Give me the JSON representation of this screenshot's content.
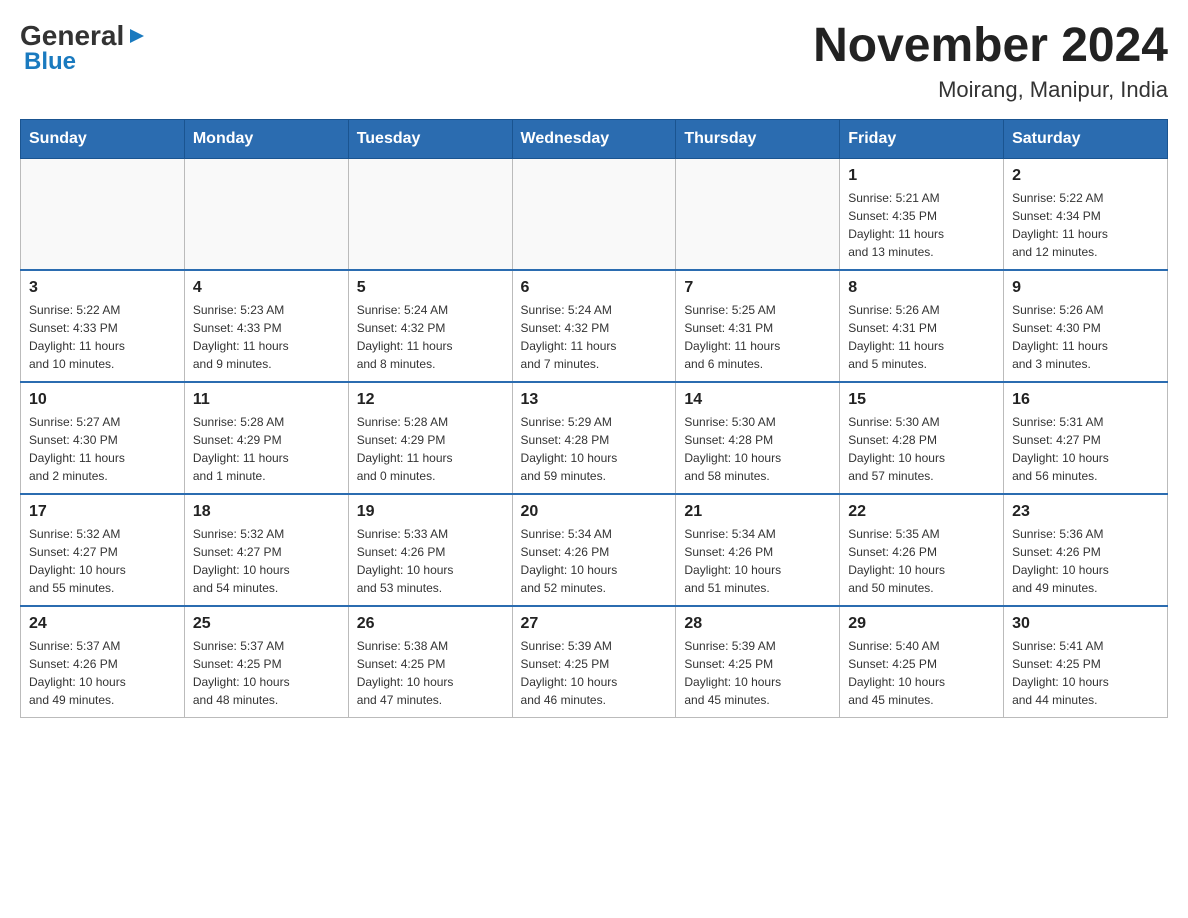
{
  "header": {
    "logo_general": "General",
    "logo_blue": "Blue",
    "month_title": "November 2024",
    "location": "Moirang, Manipur, India"
  },
  "days_of_week": [
    "Sunday",
    "Monday",
    "Tuesday",
    "Wednesday",
    "Thursday",
    "Friday",
    "Saturday"
  ],
  "weeks": [
    [
      {
        "day": "",
        "info": ""
      },
      {
        "day": "",
        "info": ""
      },
      {
        "day": "",
        "info": ""
      },
      {
        "day": "",
        "info": ""
      },
      {
        "day": "",
        "info": ""
      },
      {
        "day": "1",
        "info": "Sunrise: 5:21 AM\nSunset: 4:35 PM\nDaylight: 11 hours\nand 13 minutes."
      },
      {
        "day": "2",
        "info": "Sunrise: 5:22 AM\nSunset: 4:34 PM\nDaylight: 11 hours\nand 12 minutes."
      }
    ],
    [
      {
        "day": "3",
        "info": "Sunrise: 5:22 AM\nSunset: 4:33 PM\nDaylight: 11 hours\nand 10 minutes."
      },
      {
        "day": "4",
        "info": "Sunrise: 5:23 AM\nSunset: 4:33 PM\nDaylight: 11 hours\nand 9 minutes."
      },
      {
        "day": "5",
        "info": "Sunrise: 5:24 AM\nSunset: 4:32 PM\nDaylight: 11 hours\nand 8 minutes."
      },
      {
        "day": "6",
        "info": "Sunrise: 5:24 AM\nSunset: 4:32 PM\nDaylight: 11 hours\nand 7 minutes."
      },
      {
        "day": "7",
        "info": "Sunrise: 5:25 AM\nSunset: 4:31 PM\nDaylight: 11 hours\nand 6 minutes."
      },
      {
        "day": "8",
        "info": "Sunrise: 5:26 AM\nSunset: 4:31 PM\nDaylight: 11 hours\nand 5 minutes."
      },
      {
        "day": "9",
        "info": "Sunrise: 5:26 AM\nSunset: 4:30 PM\nDaylight: 11 hours\nand 3 minutes."
      }
    ],
    [
      {
        "day": "10",
        "info": "Sunrise: 5:27 AM\nSunset: 4:30 PM\nDaylight: 11 hours\nand 2 minutes."
      },
      {
        "day": "11",
        "info": "Sunrise: 5:28 AM\nSunset: 4:29 PM\nDaylight: 11 hours\nand 1 minute."
      },
      {
        "day": "12",
        "info": "Sunrise: 5:28 AM\nSunset: 4:29 PM\nDaylight: 11 hours\nand 0 minutes."
      },
      {
        "day": "13",
        "info": "Sunrise: 5:29 AM\nSunset: 4:28 PM\nDaylight: 10 hours\nand 59 minutes."
      },
      {
        "day": "14",
        "info": "Sunrise: 5:30 AM\nSunset: 4:28 PM\nDaylight: 10 hours\nand 58 minutes."
      },
      {
        "day": "15",
        "info": "Sunrise: 5:30 AM\nSunset: 4:28 PM\nDaylight: 10 hours\nand 57 minutes."
      },
      {
        "day": "16",
        "info": "Sunrise: 5:31 AM\nSunset: 4:27 PM\nDaylight: 10 hours\nand 56 minutes."
      }
    ],
    [
      {
        "day": "17",
        "info": "Sunrise: 5:32 AM\nSunset: 4:27 PM\nDaylight: 10 hours\nand 55 minutes."
      },
      {
        "day": "18",
        "info": "Sunrise: 5:32 AM\nSunset: 4:27 PM\nDaylight: 10 hours\nand 54 minutes."
      },
      {
        "day": "19",
        "info": "Sunrise: 5:33 AM\nSunset: 4:26 PM\nDaylight: 10 hours\nand 53 minutes."
      },
      {
        "day": "20",
        "info": "Sunrise: 5:34 AM\nSunset: 4:26 PM\nDaylight: 10 hours\nand 52 minutes."
      },
      {
        "day": "21",
        "info": "Sunrise: 5:34 AM\nSunset: 4:26 PM\nDaylight: 10 hours\nand 51 minutes."
      },
      {
        "day": "22",
        "info": "Sunrise: 5:35 AM\nSunset: 4:26 PM\nDaylight: 10 hours\nand 50 minutes."
      },
      {
        "day": "23",
        "info": "Sunrise: 5:36 AM\nSunset: 4:26 PM\nDaylight: 10 hours\nand 49 minutes."
      }
    ],
    [
      {
        "day": "24",
        "info": "Sunrise: 5:37 AM\nSunset: 4:26 PM\nDaylight: 10 hours\nand 49 minutes."
      },
      {
        "day": "25",
        "info": "Sunrise: 5:37 AM\nSunset: 4:25 PM\nDaylight: 10 hours\nand 48 minutes."
      },
      {
        "day": "26",
        "info": "Sunrise: 5:38 AM\nSunset: 4:25 PM\nDaylight: 10 hours\nand 47 minutes."
      },
      {
        "day": "27",
        "info": "Sunrise: 5:39 AM\nSunset: 4:25 PM\nDaylight: 10 hours\nand 46 minutes."
      },
      {
        "day": "28",
        "info": "Sunrise: 5:39 AM\nSunset: 4:25 PM\nDaylight: 10 hours\nand 45 minutes."
      },
      {
        "day": "29",
        "info": "Sunrise: 5:40 AM\nSunset: 4:25 PM\nDaylight: 10 hours\nand 45 minutes."
      },
      {
        "day": "30",
        "info": "Sunrise: 5:41 AM\nSunset: 4:25 PM\nDaylight: 10 hours\nand 44 minutes."
      }
    ]
  ]
}
